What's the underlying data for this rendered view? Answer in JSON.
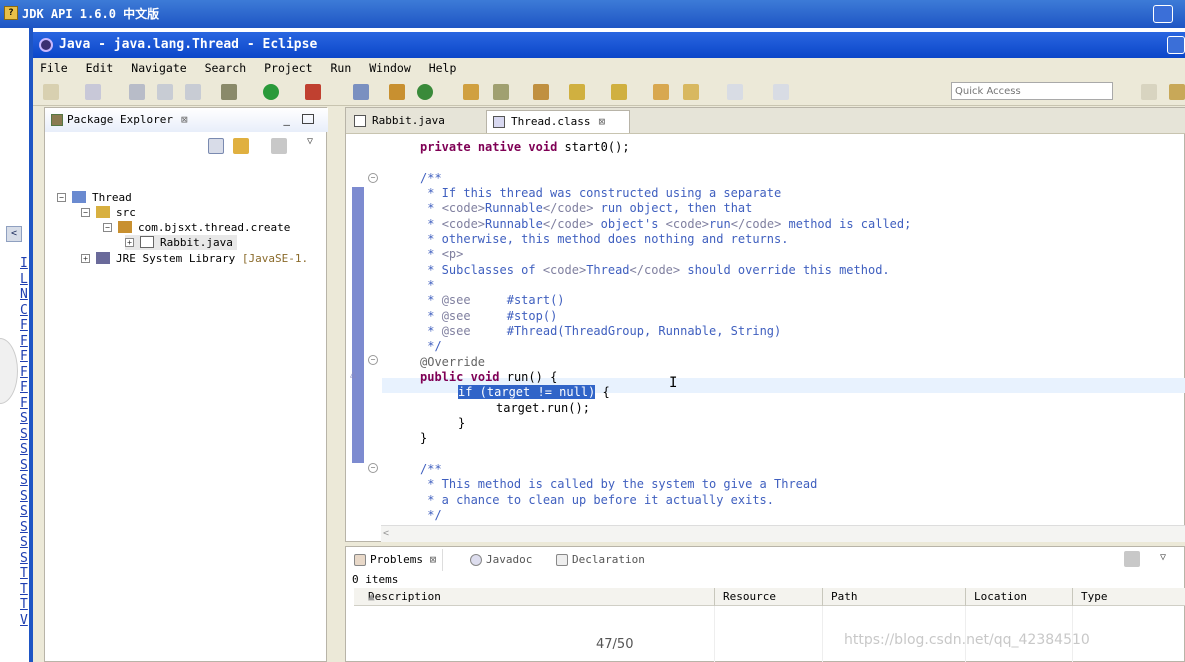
{
  "outer_window": {
    "title": "JDK API 1.6.0 中文版",
    "side_links": "I\nL\nN\nC\nF\nF\nF\nF\nF\nF\nS\nS\nS\nS\nS\nS\nS\nS\nS\nS\nT\nT\nT\nV"
  },
  "eclipse": {
    "title": "Java - java.lang.Thread - Eclipse",
    "menu": [
      "File",
      "Edit",
      "Navigate",
      "Search",
      "Project",
      "Run",
      "Window",
      "Help"
    ],
    "quick_access_placeholder": "Quick Access"
  },
  "package_explorer": {
    "tab_label": "Package Explorer",
    "tree": {
      "project": "Thread",
      "src": "src",
      "package": "com.bjsxt.thread.create",
      "file": "Rabbit.java",
      "library": "JRE System Library",
      "library_suffix": "[JavaSE-1."
    }
  },
  "editor": {
    "tabs": [
      "Rabbit.java",
      "Thread.class"
    ],
    "code": {
      "l0_kw1": "private",
      "l0_kw2": "native",
      "l0_kw3": "void",
      "l0_rest": " start0();",
      "l1": "/**",
      "l2": " * If this thread was constructed using a separate",
      "l3a": " * ",
      "l3b": "<code>",
      "l3c": "Runnable",
      "l3d": "</code>",
      "l3e": " run object, then that",
      "l4a": " * ",
      "l4b": "<code>",
      "l4c": "Runnable",
      "l4d": "</code>",
      "l4e": " object's ",
      "l4f": "<code>",
      "l4g": "run",
      "l4h": "</code>",
      "l4i": " method is called;",
      "l5": " * otherwise, this method does nothing and returns.",
      "l6a": " * ",
      "l6b": "<p>",
      "l7a": " * Subclasses of ",
      "l7b": "<code>",
      "l7c": "Thread",
      "l7d": "</code>",
      "l7e": " should override this method.",
      "l8": " *",
      "l9a": " * ",
      "l9b": "@see",
      "l9c": "     #start()",
      "l10a": " * ",
      "l10b": "@see",
      "l10c": "     #stop()",
      "l11a": " * ",
      "l11b": "@see",
      "l11c": "     #Thread(ThreadGroup, Runnable, String)",
      "l12": " */",
      "l13": "@Override",
      "l14a": "public",
      "l14b": "void",
      "l14c": " run() {",
      "l15_sel": "if (target != null)",
      "l15_rest": " {",
      "l16": "target.run();",
      "l17": "}",
      "l18": "}",
      "l19": "/**",
      "l20": " * This method is called by the system to give a Thread",
      "l21": " * a chance to clean up before it actually exits.",
      "l22": " */"
    }
  },
  "problems": {
    "tabs": [
      "Problems",
      "Javadoc",
      "Declaration"
    ],
    "items_count": "0 items",
    "columns": [
      "Description",
      "Resource",
      "Path",
      "Location",
      "Type"
    ]
  },
  "overlay": {
    "page_number": "47/50",
    "watermark": "https://blog.csdn.net/qq_42384510"
  }
}
